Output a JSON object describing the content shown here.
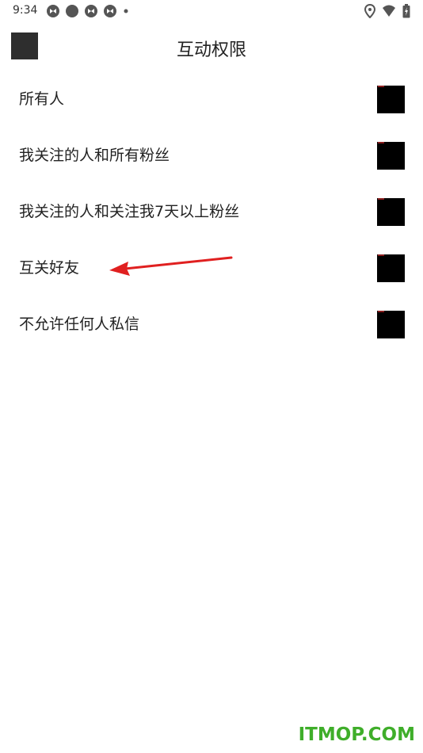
{
  "status_bar": {
    "time": "9:34",
    "icons_left": [
      "sync-icon",
      "circle-icon",
      "sync-icon",
      "sync-icon",
      "dot-icon"
    ],
    "icons_right": [
      "location-icon",
      "wifi-icon",
      "battery-charging-icon"
    ]
  },
  "toolbar": {
    "title": "互动权限",
    "back_icon": "back-icon"
  },
  "options": [
    {
      "label": "所有人",
      "selected": false
    },
    {
      "label": "我关注的人和所有粉丝",
      "selected": false
    },
    {
      "label": "我关注的人和关注我7天以上粉丝",
      "selected": false
    },
    {
      "label": "互关好友",
      "selected": false
    },
    {
      "label": "不允许任何人私信",
      "selected": false
    }
  ],
  "annotation": {
    "type": "arrow",
    "color": "#e02020",
    "points_to": "互关好友"
  },
  "watermark": {
    "text": "ITMOP.COM",
    "color": "#3fae2a"
  }
}
